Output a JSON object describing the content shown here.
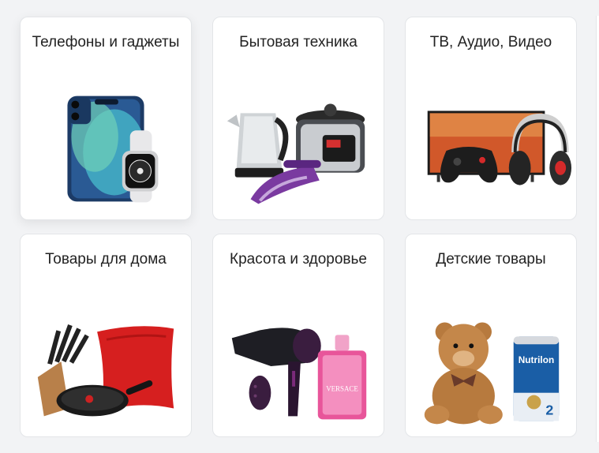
{
  "categories": [
    {
      "id": "phones",
      "title": "Телефоны и гаджеты",
      "image": "smartphone-and-smartwatch"
    },
    {
      "id": "appliances",
      "title": "Бытовая техника",
      "image": "kettle-multicooker-iron"
    },
    {
      "id": "tv",
      "title": "ТВ, Аудио, Видео",
      "image": "tv-gamepad-headphones"
    },
    {
      "id": "home",
      "title": "Товары для дома",
      "image": "knives-pan-pillow"
    },
    {
      "id": "beauty",
      "title": "Красота и здоровье",
      "image": "hairdryer-perfume"
    },
    {
      "id": "kids",
      "title": "Детские товары",
      "image": "teddy-bear-baby-formula"
    }
  ],
  "product_labels": {
    "formula_brand": "Nutrilon",
    "formula_stage": "2",
    "perfume_brand": "VERSACE"
  },
  "colors": {
    "background": "#f2f3f5",
    "card": "#ffffff",
    "text": "#222222"
  }
}
